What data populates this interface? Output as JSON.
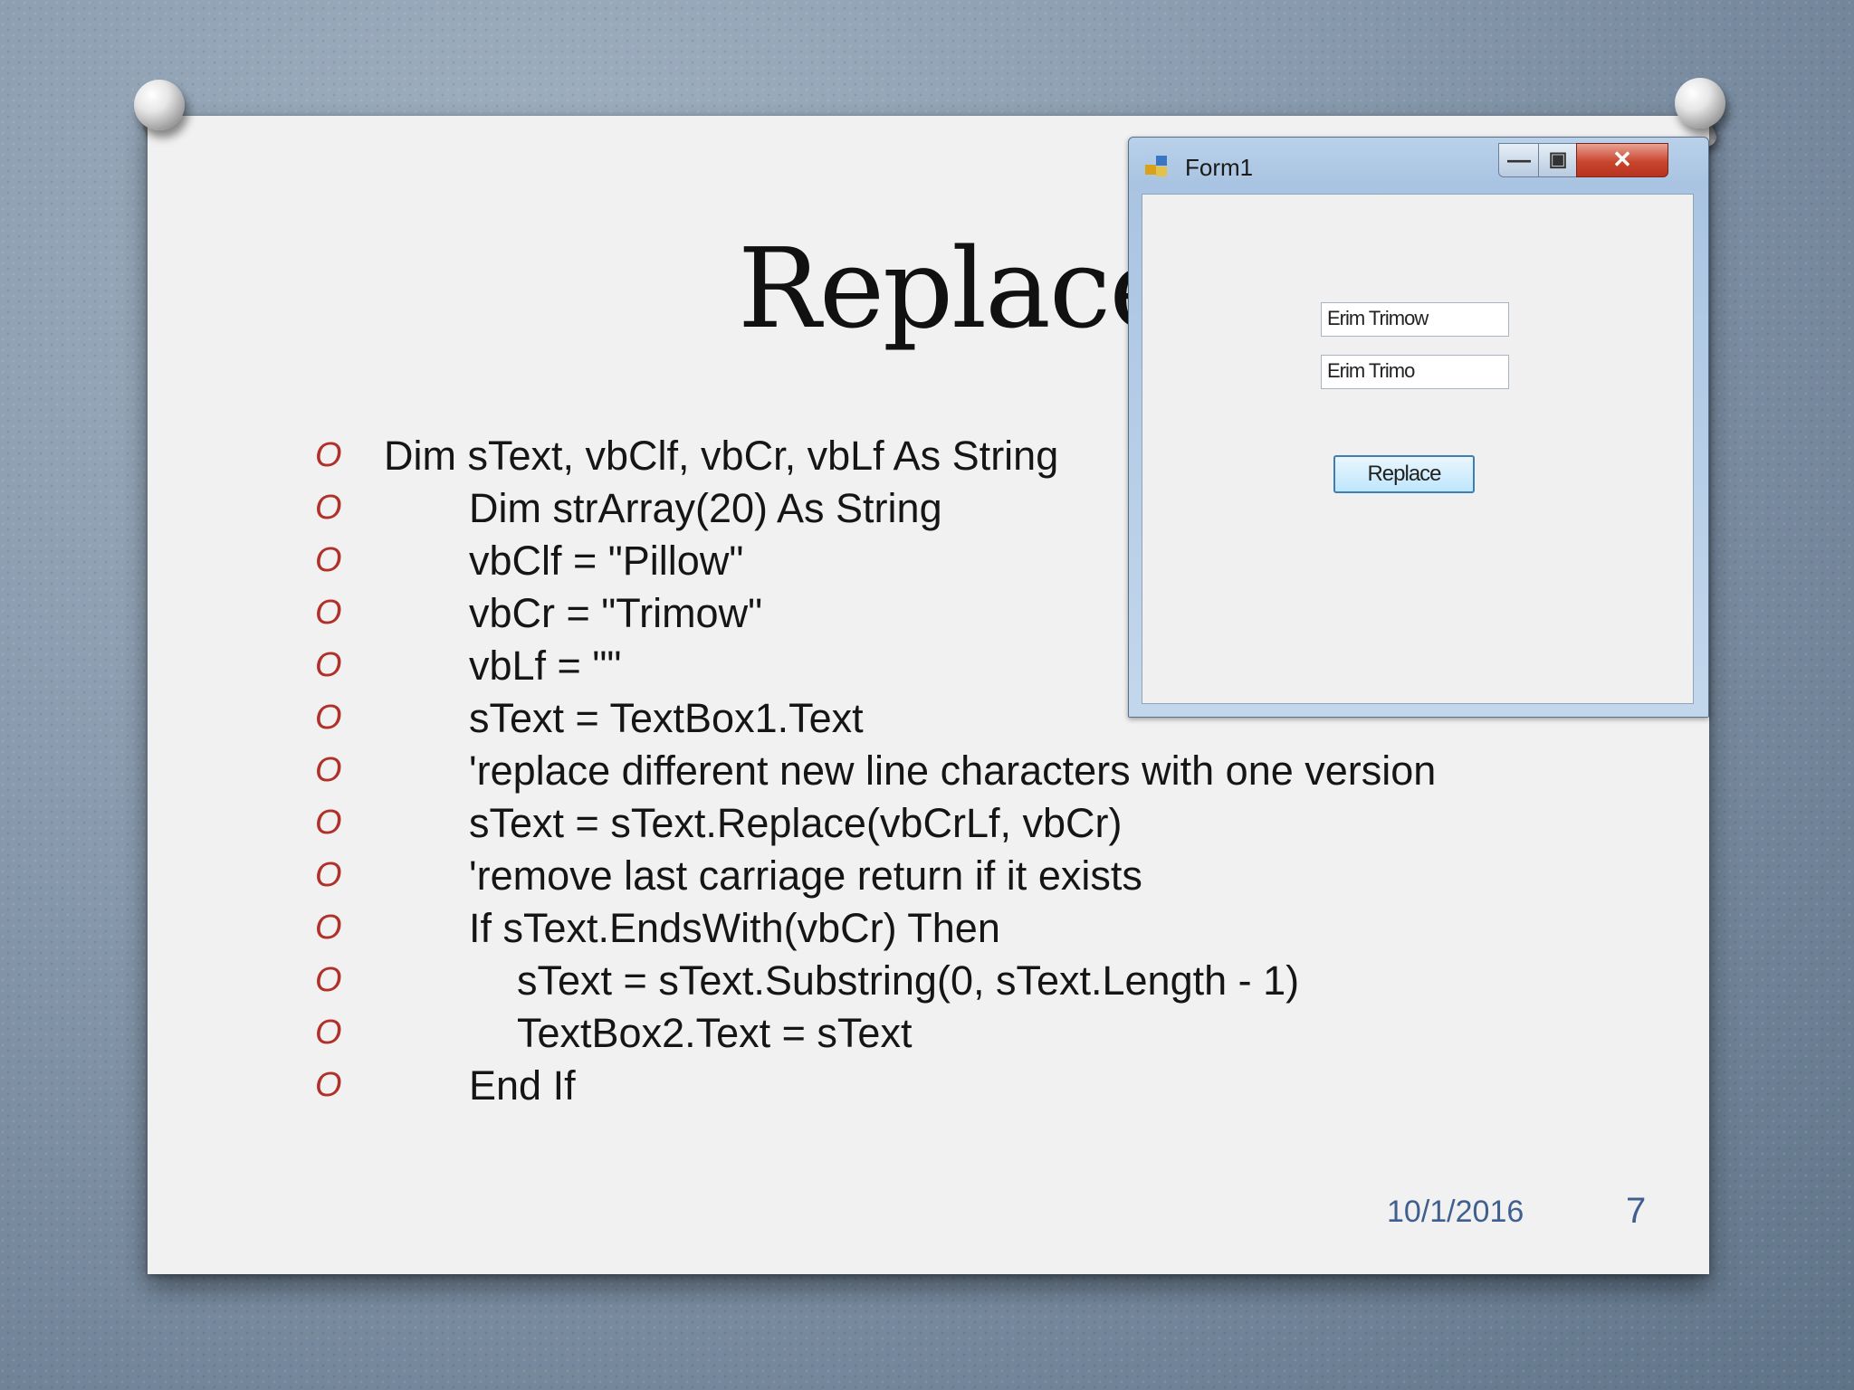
{
  "slide": {
    "title": "Replace",
    "code_lines": [
      {
        "text": "Dim sText, vbClf, vbCr, vbLf As String",
        "indent": 0
      },
      {
        "text": "Dim strArray(20) As String",
        "indent": 1
      },
      {
        "text": "vbClf = \"Pillow\"",
        "indent": 1
      },
      {
        "text": "vbCr = \"Trimow\"",
        "indent": 1
      },
      {
        "text": "vbLf = \"\"",
        "indent": 1
      },
      {
        "text": "sText = TextBox1.Text",
        "indent": 1
      },
      {
        "text": "'replace different new line characters with one version",
        "indent": 1
      },
      {
        "text": "sText = sText.Replace(vbCrLf, vbCr)",
        "indent": 1
      },
      {
        "text": "'remove last carriage return if it exists",
        "indent": 1
      },
      {
        "text": "If sText.EndsWith(vbCr) Then",
        "indent": 1
      },
      {
        "text": "sText = sText.Substring(0, sText.Length - 1)",
        "indent": 2
      },
      {
        "text": "TextBox2.Text = sText",
        "indent": 2
      },
      {
        "text": "End If",
        "indent": 1
      }
    ],
    "bullet_glyph": "O",
    "date": "10/1/2016",
    "page_number": "7"
  },
  "form_window": {
    "title": "Form1",
    "app_icon": "form-app-icon",
    "controls": {
      "minimize_icon": "minimize-icon",
      "maximize_icon": "maximize-icon",
      "close_icon": "close-icon"
    },
    "textbox1_value": "Erim Trimow",
    "textbox2_value": "Erim Trimo",
    "button_label": "Replace"
  },
  "colors": {
    "bullet": "#b0302a",
    "footer": "#3f5f8f",
    "close_button": "#c9452e",
    "button_border": "#3c7fb1"
  }
}
